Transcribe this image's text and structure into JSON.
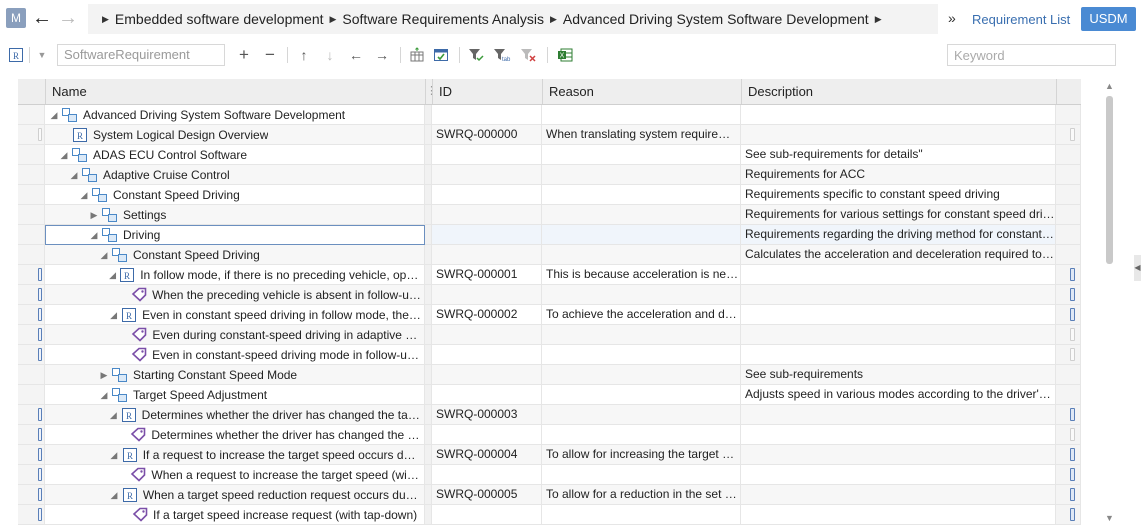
{
  "header": {
    "avatar_letter": "M",
    "breadcrumb": [
      "Embedded software development",
      "Software Requirements Analysis",
      "Advanced Driving System Software Development"
    ],
    "requirement_list_label": "Requirement List",
    "usdm_label": "USDM"
  },
  "toolbar": {
    "type_value": "SoftwareRequirement",
    "keyword_placeholder": "Keyword"
  },
  "table": {
    "columns": [
      "Name",
      "ID",
      "Reason",
      "Description"
    ],
    "rows": [
      {
        "level": 0,
        "toggle": "expanded",
        "icon": "group",
        "name": "Advanced Driving System Software Development",
        "id": "",
        "reason": "",
        "desc": "",
        "sel": "",
        "end": ""
      },
      {
        "level": 1,
        "toggle": "none",
        "icon": "requirement",
        "name": "System Logical Design Overview",
        "id": "SWRQ-000000",
        "reason": "When translating system requirements into software requirements",
        "desc": "",
        "sel": "light",
        "end": "light"
      },
      {
        "level": 1,
        "toggle": "expanded",
        "icon": "group",
        "name": "ADAS ECU Control Software",
        "id": "",
        "reason": "",
        "desc": "See sub-requirements for details\"",
        "sel": "",
        "end": ""
      },
      {
        "level": 2,
        "toggle": "expanded",
        "icon": "group",
        "name": "Adaptive Cruise Control",
        "id": "",
        "reason": "",
        "desc": "Requirements for ACC",
        "sel": "",
        "end": ""
      },
      {
        "level": 3,
        "toggle": "expanded",
        "icon": "group",
        "name": "Constant Speed Driving",
        "id": "",
        "reason": "",
        "desc": "Requirements specific to constant speed driving",
        "sel": "",
        "end": ""
      },
      {
        "level": 4,
        "toggle": "collapsed",
        "icon": "group",
        "name": "Settings",
        "id": "",
        "reason": "",
        "desc": "Requirements for various settings for constant speed driving",
        "sel": "",
        "end": ""
      },
      {
        "level": 4,
        "toggle": "expanded",
        "icon": "group",
        "name": "Driving",
        "id": "",
        "reason": "",
        "desc": "Requirements regarding the driving method for constant speed driving",
        "sel": "",
        "end": "",
        "selected": true
      },
      {
        "level": 5,
        "toggle": "expanded",
        "icon": "group",
        "name": "Constant Speed Driving",
        "id": "",
        "reason": "",
        "desc": "Calculates the acceleration and deceleration required to maintain speed",
        "sel": "",
        "end": ""
      },
      {
        "level": 6,
        "toggle": "expanded",
        "icon": "requirement",
        "name": "In follow mode, if there is no preceding vehicle, operate in constant speed",
        "id": "SWRQ-000001",
        "reason": "This is because acceleration is necessary",
        "desc": "",
        "sel": "dark",
        "end": "dark"
      },
      {
        "level": 7,
        "toggle": "none",
        "icon": "spec",
        "name": "When the preceding vehicle is absent in follow-up mode",
        "id": "",
        "reason": "",
        "desc": "",
        "sel": "dark",
        "end": "dark"
      },
      {
        "level": 6,
        "toggle": "expanded",
        "icon": "requirement",
        "name": "Even in constant speed driving in follow mode, the vehicle",
        "id": "SWRQ-000002",
        "reason": "To achieve the acceleration and deceleration",
        "desc": "",
        "sel": "dark",
        "end": "dark"
      },
      {
        "level": 7,
        "toggle": "none",
        "icon": "spec",
        "name": "Even during constant-speed driving in adaptive cruise",
        "id": "",
        "reason": "",
        "desc": "",
        "sel": "dark",
        "end": "light"
      },
      {
        "level": 7,
        "toggle": "none",
        "icon": "spec",
        "name": "Even in constant-speed driving mode in follow-up mode",
        "id": "",
        "reason": "",
        "desc": "",
        "sel": "dark",
        "end": "light"
      },
      {
        "level": 5,
        "toggle": "collapsed",
        "icon": "group",
        "name": "Starting Constant Speed Mode",
        "id": "",
        "reason": "",
        "desc": "See sub-requirements",
        "sel": "",
        "end": ""
      },
      {
        "level": 5,
        "toggle": "expanded",
        "icon": "group",
        "name": "Target Speed Adjustment",
        "id": "",
        "reason": "",
        "desc": "Adjusts speed in various modes according to the driver's operation",
        "sel": "",
        "end": ""
      },
      {
        "level": 6,
        "toggle": "expanded",
        "icon": "requirement",
        "name": "Determines whether the driver has changed the target speed",
        "id": "SWRQ-000003",
        "reason": "",
        "desc": "",
        "sel": "dark",
        "end": "dark"
      },
      {
        "level": 7,
        "toggle": "none",
        "icon": "spec",
        "name": "Determines whether the driver has changed the target speed",
        "id": "",
        "reason": "",
        "desc": "",
        "sel": "dark",
        "end": "light"
      },
      {
        "level": 6,
        "toggle": "expanded",
        "icon": "requirement",
        "name": "If a request to increase the target speed occurs during",
        "id": "SWRQ-000004",
        "reason": "To allow for increasing the target speed",
        "desc": "",
        "sel": "dark",
        "end": "dark"
      },
      {
        "level": 7,
        "toggle": "none",
        "icon": "spec",
        "name": "When a request to increase the target speed (with tap-down)",
        "id": "",
        "reason": "",
        "desc": "",
        "sel": "dark",
        "end": "dark"
      },
      {
        "level": 6,
        "toggle": "expanded",
        "icon": "requirement",
        "name": "When a target speed reduction request occurs during",
        "id": "SWRQ-000005",
        "reason": "To allow for a reduction in the set speed",
        "desc": "",
        "sel": "dark",
        "end": "dark"
      },
      {
        "level": 7,
        "toggle": "none",
        "icon": "spec",
        "name": "If a target speed increase request (with tap-down)",
        "id": "",
        "reason": "",
        "desc": "",
        "sel": "dark",
        "end": "dark"
      }
    ]
  }
}
